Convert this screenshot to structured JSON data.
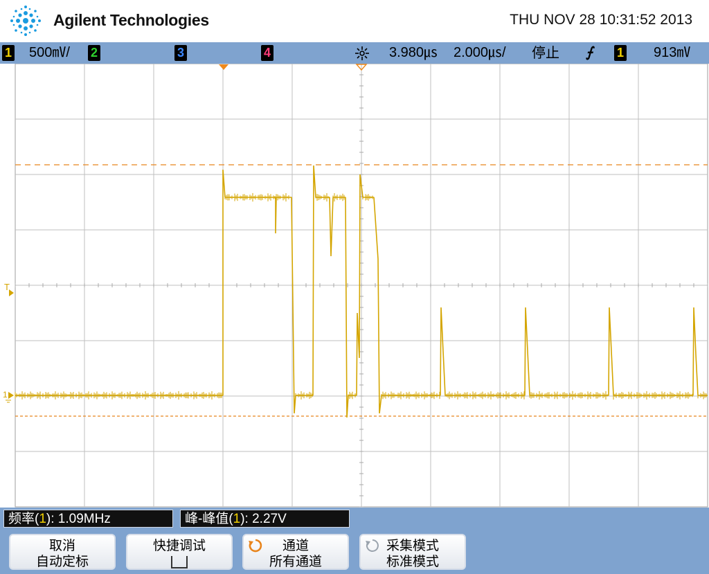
{
  "header": {
    "brand": "Agilent Technologies",
    "datetime": "THU NOV 28 10:31:52 2013"
  },
  "status": {
    "ch1": {
      "label": "1",
      "scale": "500㎷/"
    },
    "ch2": {
      "label": "2"
    },
    "ch3": {
      "label": "3"
    },
    "ch4": {
      "label": "4"
    },
    "delay": "3.980㎲",
    "timebase": "2.000㎲/",
    "run_state": "停止",
    "trigger_slope": "⨍",
    "trigger_source": "1",
    "trigger_level": "913㎷"
  },
  "screen": {
    "trigger_marker": "T",
    "ground_marker": "1"
  },
  "measurements": {
    "freq": {
      "label": "频率(",
      "src": "1",
      "rest": "): 1.09MHz"
    },
    "pkpk": {
      "label": "峰-峰值(",
      "src": "1",
      "rest": "): 2.27V"
    }
  },
  "softkeys": [
    {
      "line1": "取消",
      "line2": "自动定标"
    },
    {
      "line1": "快捷调试",
      "line2": ""
    },
    {
      "line1": "通道",
      "line2": "所有通道"
    },
    {
      "line1": "采集模式",
      "line2": "标准模式"
    }
  ],
  "colors": {
    "ch1": "#f2d200",
    "trace": "#d4a500",
    "cursor": "#e8841c",
    "statusbar": "#7fa3cf",
    "grid": "#bfbfbf"
  }
}
